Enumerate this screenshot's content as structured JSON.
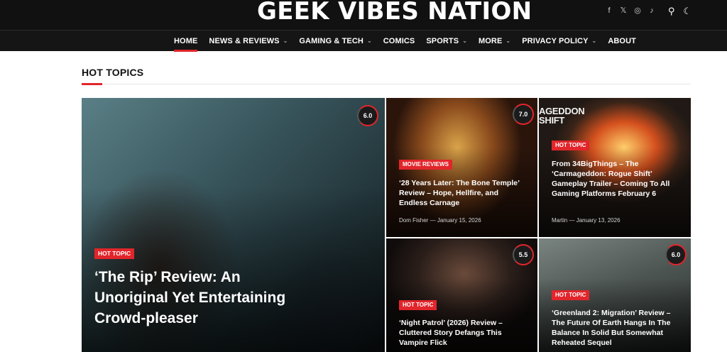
{
  "site": {
    "logo": "GEEK VIBES NATION"
  },
  "socials": [
    {
      "icon": "facebook-icon",
      "glyph": "f"
    },
    {
      "icon": "x-icon",
      "glyph": "𝕏"
    },
    {
      "icon": "instagram-icon",
      "glyph": "◎"
    },
    {
      "icon": "tiktok-icon",
      "glyph": "♪"
    }
  ],
  "tools": {
    "search_glyph": "⚲",
    "theme_glyph": "☾"
  },
  "nav": [
    {
      "label": "HOME",
      "dropdown": false,
      "active": true
    },
    {
      "label": "NEWS & REVIEWS",
      "dropdown": true
    },
    {
      "label": "GAMING & TECH",
      "dropdown": true
    },
    {
      "label": "COMICS",
      "dropdown": false
    },
    {
      "label": "SPORTS",
      "dropdown": true
    },
    {
      "label": "MORE",
      "dropdown": true
    },
    {
      "label": "PRIVACY POLICY",
      "dropdown": true
    },
    {
      "label": "ABOUT",
      "dropdown": false
    }
  ],
  "section": {
    "title": "HOT TOPICS"
  },
  "featured": {
    "score": "6.0",
    "tag": "HOT TOPIC",
    "title": "‘The Rip’ Review: An Unoriginal Yet Entertaining Crowd-pleaser"
  },
  "cards": [
    {
      "score": "7.0",
      "tag": "MOVIE REVIEWS",
      "title": "‘28 Years Later: The Bone Temple’ Review – Hope, Hellfire, and Endless Carnage",
      "author": "Dom Fisher",
      "date": "January 15, 2026"
    },
    {
      "overlay_text": "AGEDDON\nSHIFT",
      "tag": "HOT TOPIC",
      "title": "From 34BigThings – The ‘Carmageddon: Rogue Shift’ Gameplay Trailer – Coming To All Gaming Platforms February 6",
      "author": "Martin",
      "date": "January 13, 2026"
    },
    {
      "score": "5.5",
      "tag": "HOT TOPIC",
      "title": "‘Night Patrol’ (2026) Review – Cluttered Story Defangs This Vampire Flick"
    },
    {
      "score": "6.0",
      "tag": "HOT TOPIC",
      "title": "‘Greenland 2: Migration’ Review – The Future Of Earth Hangs In The Balance In Solid But Somewhat Reheated Sequel"
    }
  ],
  "colors": {
    "accent": "#e2252b",
    "header_bg": "#111111",
    "nav_bg": "#151515"
  }
}
